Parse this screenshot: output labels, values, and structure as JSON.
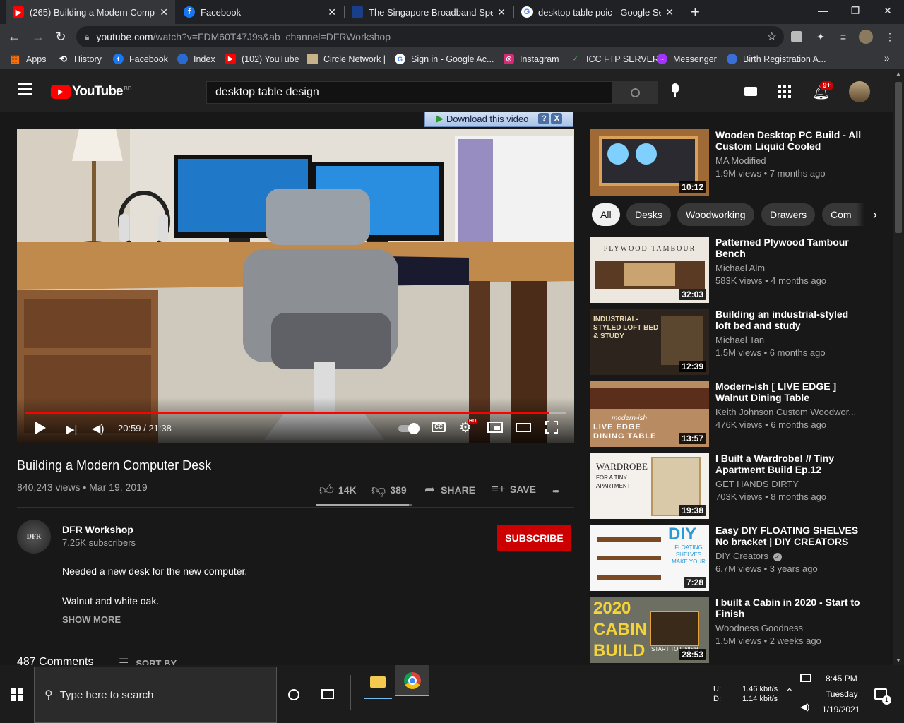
{
  "browser": {
    "tabs": [
      {
        "label": "(265) Building a Modern Comput",
        "close": "✕",
        "active": true
      },
      {
        "label": "Facebook",
        "close": "✕",
        "active": false
      },
      {
        "label": "The Singapore Broadband Speed",
        "close": "✕",
        "active": false
      },
      {
        "label": "desktop table poic - Google Sear",
        "close": "✕",
        "active": false
      }
    ],
    "new_tab": "+",
    "url_host": "youtube.com",
    "url_path": "/watch?v=FDM60T47J9s&ab_channel=DFRWorkshop",
    "bookmarks": [
      {
        "label": "Apps",
        "icon": "apps-grid-icon"
      },
      {
        "label": "History",
        "icon": "history-icon"
      },
      {
        "label": "Facebook",
        "icon": "facebook-icon"
      },
      {
        "label": "Index",
        "icon": "index-icon"
      },
      {
        "label": "(102) YouTube",
        "icon": "youtube-icon"
      },
      {
        "label": "Circle Network |",
        "icon": "circle-network-icon"
      },
      {
        "label": "Sign in - Google Ac...",
        "icon": "google-icon"
      },
      {
        "label": "Instagram",
        "icon": "instagram-icon"
      },
      {
        "label": "ICC FTP SERVER",
        "icon": "icc-icon"
      },
      {
        "label": "Messenger",
        "icon": "messenger-icon"
      },
      {
        "label": "Birth Registration A...",
        "icon": "birth-reg-icon"
      }
    ],
    "bookmarks_more": "»"
  },
  "youtube": {
    "logo_text": "YouTube",
    "logo_region": "BD",
    "search_value": "desktop table design",
    "notifications_badge": "9+",
    "download_bar": "Download this video",
    "download_help": "?",
    "download_close": "X",
    "player": {
      "time": "20:59 / 21:38",
      "progress": 0.97,
      "hd_badge": "HD"
    },
    "video": {
      "title": "Building a Modern Computer Desk",
      "views_date": "840,243 views • Mar 19, 2019",
      "likes": "14K",
      "dislikes": "389",
      "like_ratio": 0.97,
      "share": "SHARE",
      "save": "SAVE",
      "more": "•••"
    },
    "channel": {
      "name": "DFR Workshop",
      "subscribers": "7.25K subscribers",
      "avatar_text": "DFR",
      "subscribe": "SUBSCRIBE"
    },
    "description": {
      "line1": "Needed a new desk for the new computer.",
      "line2": "Walnut and white oak.",
      "show_more": "SHOW MORE"
    },
    "comments": {
      "count": "487 Comments",
      "sort": "SORT BY"
    },
    "chips": [
      "All",
      "Desks",
      "Woodworking",
      "Drawers",
      "Com"
    ],
    "recommendations": [
      {
        "title": "Wooden Desktop PC Build - All Custom Liquid Cooled",
        "channel": "MA Modified",
        "meta": "1.9M views • 7 months ago",
        "duration": "10:12",
        "verified": false
      },
      {
        "title": "Patterned Plywood Tambour Bench",
        "channel": "Michael Alm",
        "meta": "583K views • 4 months ago",
        "duration": "32:03",
        "verified": false,
        "thumb_text": "PLYWOOD TAMBOUR"
      },
      {
        "title": "Building an industrial-styled loft bed and study",
        "channel": "Michael Tan",
        "meta": "1.5M views • 6 months ago",
        "duration": "12:39",
        "verified": false,
        "thumb_text": "INDUSTRIAL-STYLED LOFT BED & STUDY"
      },
      {
        "title": "Modern-ish [ LIVE EDGE ] Walnut Dining Table",
        "channel": "Keith Johnson Custom Woodwor...",
        "meta": "476K views • 6 months ago",
        "duration": "13:57",
        "verified": false,
        "thumb_text": "LIVE EDGE DINING TABLE",
        "thumb_text_small": "modern-ish"
      },
      {
        "title": "I Built a Wardrobe! // Tiny Apartment Build Ep.12",
        "channel": "GET HANDS DIRTY",
        "meta": "703K views • 8 months ago",
        "duration": "19:38",
        "verified": false,
        "thumb_text": "WARDROBE",
        "thumb_text_small": "FOR A TINY APARTMENT"
      },
      {
        "title": "Easy DIY FLOATING SHELVES No bracket | DIY CREATORS",
        "channel": "DIY Creators",
        "meta": "6.7M views • 3 years ago",
        "duration": "7:28",
        "verified": true,
        "thumb_text": "DIY",
        "thumb_text_small": "FLOATING SHELVES MAKE YOUR"
      },
      {
        "title": "I built a Cabin in 2020 - Start to Finish",
        "channel": "Woodness Goodness",
        "meta": "1.5M views • 2 weeks ago",
        "duration": "28:53",
        "verified": false,
        "thumb_text": "2020 CABIN BUILD",
        "thumb_text_small": "START TO FINISH"
      }
    ]
  },
  "taskbar": {
    "search_placeholder": "Type here to search",
    "net_up_label": "U:",
    "net_down_label": "D:",
    "net_up": "1.46 kbit/s",
    "net_down": "1.14 kbit/s",
    "time": "8:45 PM",
    "day": "Tuesday",
    "date": "1/19/2021",
    "notif_count": "1"
  },
  "colors": {
    "yt_red": "#ff0000",
    "subscribe_red": "#cc0000",
    "page_bg": "#181818",
    "header_bg": "#212121"
  }
}
